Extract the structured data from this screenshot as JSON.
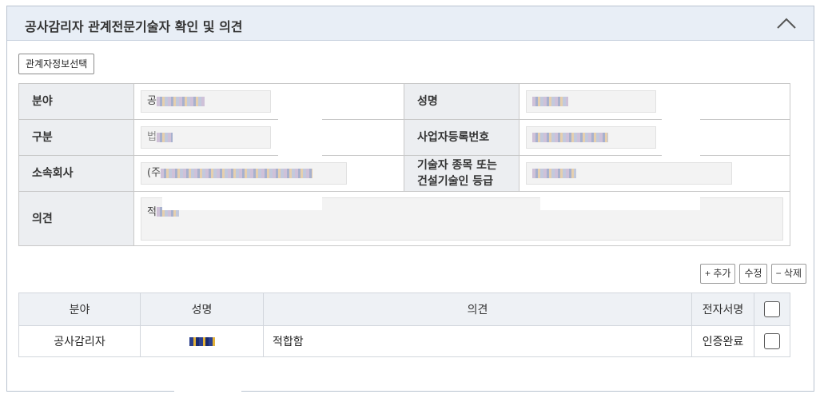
{
  "header": {
    "title": "공사감리자 관계전문기술자 확인 및 의견"
  },
  "toolbar": {
    "select_label": "관계자정보선택",
    "add_label": "+ 추가",
    "edit_label": "수정",
    "delete_label": "− 삭제"
  },
  "form": {
    "field_label": "분야",
    "field_value_prefix": "공",
    "name_label": "성명",
    "type_label": "구분",
    "type_value_prefix": "법",
    "biz_label": "사업자등록번호",
    "company_label": "소속회사",
    "company_value_prefix": "(주",
    "grade_label_line1": "기술자 종목 또는",
    "grade_label_line2": "건설기술인 등급",
    "opinion_label": "의견",
    "opinion_value_prefix": "적"
  },
  "list": {
    "columns": [
      "분야",
      "성명",
      "의견",
      "전자서명"
    ],
    "rows": [
      {
        "field": "공사감리자",
        "opinion": "적합함",
        "signature": "인증완료"
      }
    ]
  }
}
